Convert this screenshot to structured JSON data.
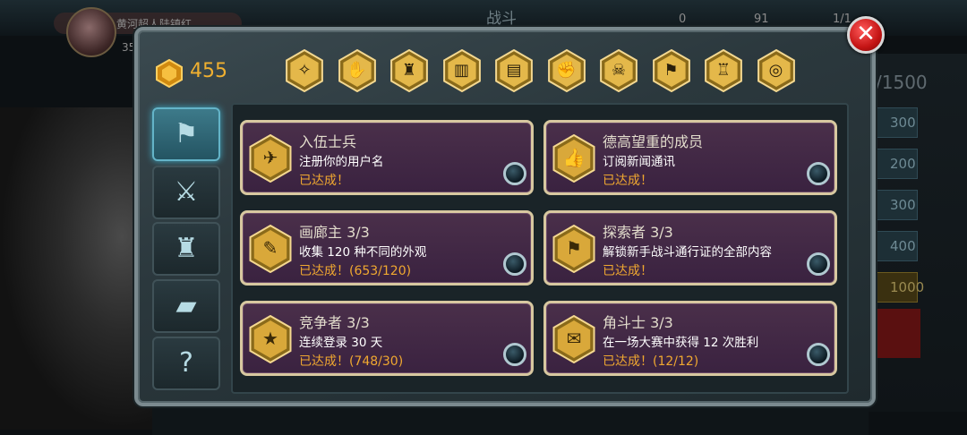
{
  "background": {
    "title": "战斗",
    "player_name": "黄河超人陆镇红",
    "player_level": "35",
    "stat_a": "0",
    "stat_b": "91",
    "stat_c": "1/1",
    "xp_text": "/1500",
    "reward_rows": [
      "300",
      "200",
      "300",
      "400",
      "1000"
    ]
  },
  "currency": {
    "value": "455",
    "icon": "gold-hexagon-icon"
  },
  "categories": [
    {
      "icon": "constellation-icon",
      "glyph": "✧"
    },
    {
      "icon": "gloves-icon",
      "glyph": "✋"
    },
    {
      "icon": "robot-icon",
      "glyph": "♜"
    },
    {
      "icon": "book-icon",
      "glyph": "▥"
    },
    {
      "icon": "cards-icon",
      "glyph": "▤"
    },
    {
      "icon": "weight-icon",
      "glyph": "✊"
    },
    {
      "icon": "skulls-icon",
      "glyph": "☠"
    },
    {
      "icon": "banner-icon",
      "glyph": "⚑"
    },
    {
      "icon": "armor-icon",
      "glyph": "♖"
    },
    {
      "icon": "target-icon",
      "glyph": "◎"
    }
  ],
  "side_tabs": [
    {
      "icon": "flag-icon",
      "glyph": "⚑",
      "active": true
    },
    {
      "icon": "crossed-swords-icon",
      "glyph": "⚔",
      "active": false
    },
    {
      "icon": "armor-icon",
      "glyph": "♜",
      "active": false
    },
    {
      "icon": "card-icon",
      "glyph": "▰",
      "active": false
    },
    {
      "icon": "question-icon",
      "glyph": "?",
      "active": false
    }
  ],
  "achievements": [
    {
      "title": "入伍士兵",
      "desc": "注册你的用户名",
      "status": "已达成！",
      "icon": "eagle-icon",
      "glyph": "✈"
    },
    {
      "title": "德高望重的成员",
      "desc": "订阅新闻通讯",
      "status": "已达成！",
      "icon": "thumbs-up-icon",
      "glyph": "👍"
    },
    {
      "title": "画廊主 3/3",
      "desc": "收集 120 种不同的外观",
      "status": "已达成！(653/120)",
      "icon": "brush-icon",
      "glyph": "✎"
    },
    {
      "title": "探索者 3/3",
      "desc": "解锁新手战斗通行证的全部内容",
      "status": "已达成！",
      "icon": "flag-icon",
      "glyph": "⚑"
    },
    {
      "title": "竞争者 3/3",
      "desc": "连续登录 30 天",
      "status": "已达成！(748/30)",
      "icon": "calendar-icon",
      "glyph": "★"
    },
    {
      "title": "角斗士 3/3",
      "desc": "在一场大赛中获得 12 次胜利",
      "status": "已达成！(12/12)",
      "icon": "scroll-icon",
      "glyph": "✉"
    }
  ],
  "colors": {
    "accent_gold": "#f0b030",
    "card_purple": "#3a2240",
    "status_orange": "#f0a830",
    "close_red": "#c41414"
  }
}
